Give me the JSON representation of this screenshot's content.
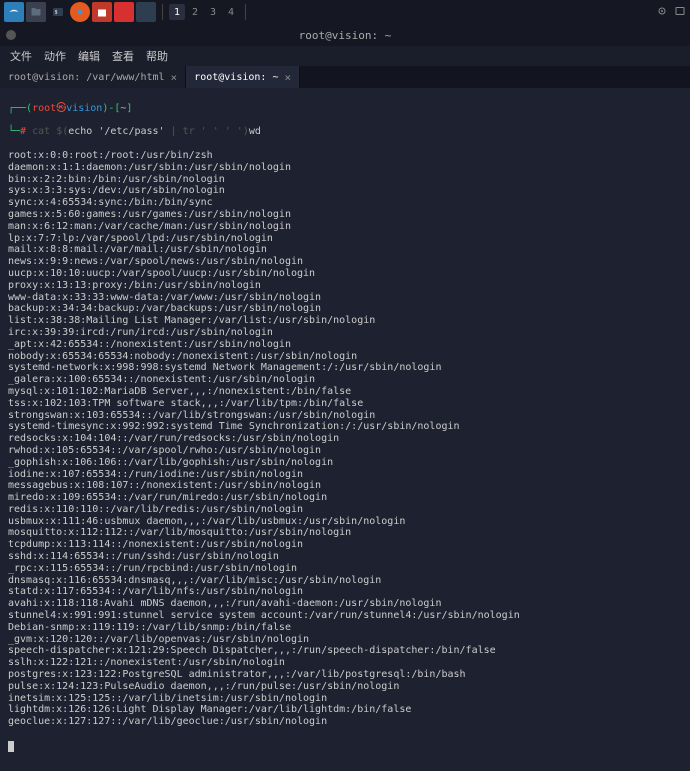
{
  "taskbar": {
    "workspaces": [
      "1",
      "2",
      "3",
      "4"
    ]
  },
  "window": {
    "title": "root@vision: ~"
  },
  "menu": {
    "file": "文件",
    "actions": "动作",
    "edit": "编辑",
    "view": "查看",
    "help": "帮助"
  },
  "tabs": [
    {
      "label": "root@vision: /var/www/html",
      "active": false
    },
    {
      "label": "root@vision: ~",
      "active": true
    }
  ],
  "prompt": {
    "open": "┌──(",
    "user": "root",
    "sep": "㉿",
    "host": "vision",
    "close": ")-[",
    "path": "~",
    "end": "]",
    "line2_prefix": "└─",
    "symbol": "#"
  },
  "command": {
    "dim_before": "cat $(",
    "inner": "echo '/etc/pass'",
    "dim_mid": " | tr ' ' ' ')",
    "suffix": "wd"
  },
  "output": [
    "root:x:0:0:root:/root:/usr/bin/zsh",
    "daemon:x:1:1:daemon:/usr/sbin:/usr/sbin/nologin",
    "bin:x:2:2:bin:/bin:/usr/sbin/nologin",
    "sys:x:3:3:sys:/dev:/usr/sbin/nologin",
    "sync:x:4:65534:sync:/bin:/bin/sync",
    "games:x:5:60:games:/usr/games:/usr/sbin/nologin",
    "man:x:6:12:man:/var/cache/man:/usr/sbin/nologin",
    "lp:x:7:7:lp:/var/spool/lpd:/usr/sbin/nologin",
    "mail:x:8:8:mail:/var/mail:/usr/sbin/nologin",
    "news:x:9:9:news:/var/spool/news:/usr/sbin/nologin",
    "uucp:x:10:10:uucp:/var/spool/uucp:/usr/sbin/nologin",
    "proxy:x:13:13:proxy:/bin:/usr/sbin/nologin",
    "www-data:x:33:33:www-data:/var/www:/usr/sbin/nologin",
    "backup:x:34:34:backup:/var/backups:/usr/sbin/nologin",
    "list:x:38:38:Mailing List Manager:/var/list:/usr/sbin/nologin",
    "irc:x:39:39:ircd:/run/ircd:/usr/sbin/nologin",
    "_apt:x:42:65534::/nonexistent:/usr/sbin/nologin",
    "nobody:x:65534:65534:nobody:/nonexistent:/usr/sbin/nologin",
    "systemd-network:x:998:998:systemd Network Management:/:/usr/sbin/nologin",
    "_galera:x:100:65534::/nonexistent:/usr/sbin/nologin",
    "mysql:x:101:102:MariaDB Server,,,:/nonexistent:/bin/false",
    "tss:x:102:103:TPM software stack,,,:/var/lib/tpm:/bin/false",
    "strongswan:x:103:65534::/var/lib/strongswan:/usr/sbin/nologin",
    "systemd-timesync:x:992:992:systemd Time Synchronization:/:/usr/sbin/nologin",
    "redsocks:x:104:104::/var/run/redsocks:/usr/sbin/nologin",
    "rwhod:x:105:65534::/var/spool/rwho:/usr/sbin/nologin",
    "_gophish:x:106:106::/var/lib/gophish:/usr/sbin/nologin",
    "iodine:x:107:65534::/run/iodine:/usr/sbin/nologin",
    "messagebus:x:108:107::/nonexistent:/usr/sbin/nologin",
    "miredo:x:109:65534::/var/run/miredo:/usr/sbin/nologin",
    "redis:x:110:110::/var/lib/redis:/usr/sbin/nologin",
    "usbmux:x:111:46:usbmux daemon,,,:/var/lib/usbmux:/usr/sbin/nologin",
    "mosquitto:x:112:112::/var/lib/mosquitto:/usr/sbin/nologin",
    "tcpdump:x:113:114::/nonexistent:/usr/sbin/nologin",
    "sshd:x:114:65534::/run/sshd:/usr/sbin/nologin",
    "_rpc:x:115:65534::/run/rpcbind:/usr/sbin/nologin",
    "dnsmasq:x:116:65534:dnsmasq,,,:/var/lib/misc:/usr/sbin/nologin",
    "statd:x:117:65534::/var/lib/nfs:/usr/sbin/nologin",
    "avahi:x:118:118:Avahi mDNS daemon,,,:/run/avahi-daemon:/usr/sbin/nologin",
    "stunnel4:x:991:991:stunnel service system account:/var/run/stunnel4:/usr/sbin/nologin",
    "Debian-snmp:x:119:119::/var/lib/snmp:/bin/false",
    "_gvm:x:120:120::/var/lib/openvas:/usr/sbin/nologin",
    "speech-dispatcher:x:121:29:Speech Dispatcher,,,:/run/speech-dispatcher:/bin/false",
    "sslh:x:122:121::/nonexistent:/usr/sbin/nologin",
    "postgres:x:123:122:PostgreSQL administrator,,,:/var/lib/postgresql:/bin/bash",
    "pulse:x:124:123:PulseAudio daemon,,,:/run/pulse:/usr/sbin/nologin",
    "inetsim:x:125:125::/var/lib/inetsim:/usr/sbin/nologin",
    "lightdm:x:126:126:Light Display Manager:/var/lib/lightdm:/bin/false",
    "geoclue:x:127:127::/var/lib/geoclue:/usr/sbin/nologin"
  ]
}
